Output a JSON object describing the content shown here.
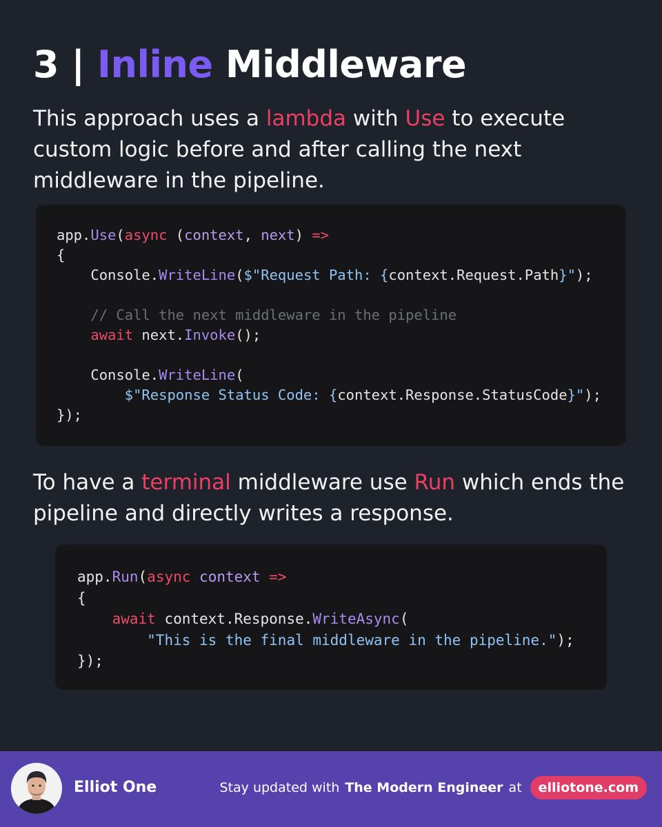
{
  "title": {
    "number": "3 |",
    "accent": "Inline",
    "rest": "Middleware"
  },
  "intro": {
    "t1": "This approach uses a ",
    "h1": "lambda",
    "t2": " with ",
    "h2": "Use",
    "t3": " to execute custom logic before and after calling the next middleware in the pipeline."
  },
  "code1": [
    "app.Use(async (context, next) =>",
    "{",
    "    Console.WriteLine($\"Request Path: {context.Request.Path}\");",
    "",
    "    // Call the next middleware in the pipeline",
    "    await next.Invoke();",
    "",
    "    Console.WriteLine(",
    "        $\"Response Status Code: {context.Response.StatusCode}\");",
    "});"
  ],
  "second": {
    "t1": "To have a ",
    "h1": "terminal",
    "t2": " middleware use ",
    "h2": "Run",
    "t3": " which ends the pipeline and directly writes a response."
  },
  "code2": [
    "app.Run(async context =>",
    "{",
    "    await context.Response.WriteAsync(",
    "        \"This is the final middleware in the pipeline.\");",
    "});"
  ],
  "footer": {
    "author": "Elliot One",
    "tagline_prefix": "Stay updated with",
    "brand": "The Modern Engineer",
    "tagline_at": "at",
    "site": "elliotone.com"
  },
  "colors": {
    "background": "#1e222a",
    "accent": "#7b5cf2",
    "highlight": "#ec3f63",
    "footer": "#5642ad",
    "code_bg": "#161618"
  }
}
